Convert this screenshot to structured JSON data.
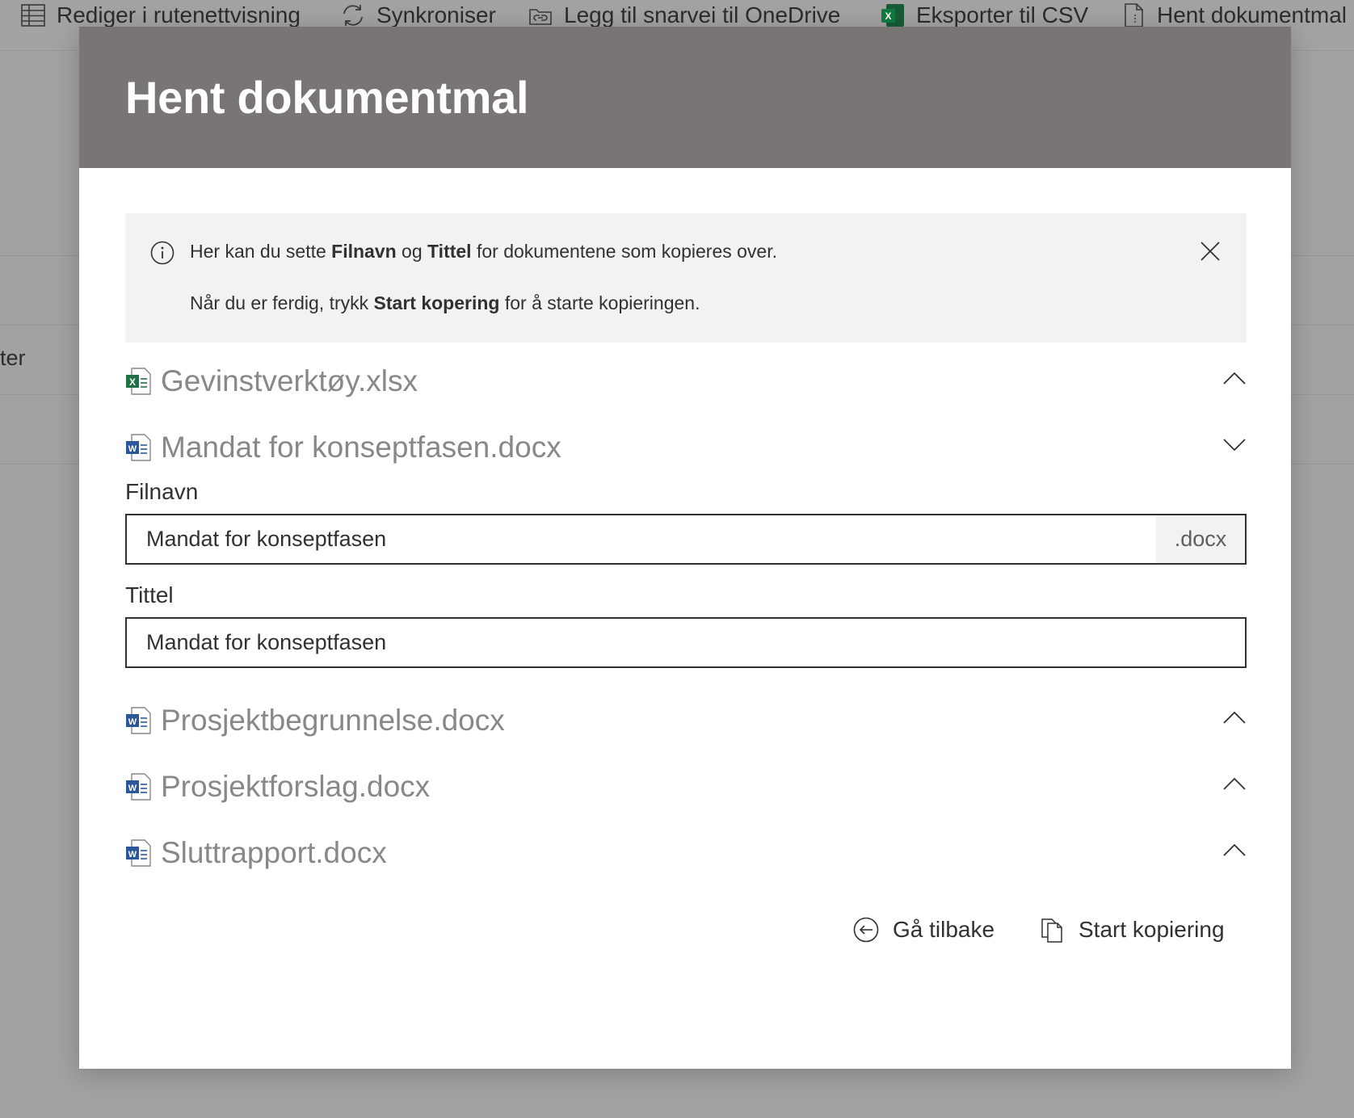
{
  "background": {
    "commands": [
      {
        "label": "Rediger i rutenettvisning",
        "icon": "grid-icon"
      },
      {
        "label": "Synkroniser",
        "icon": "sync-icon"
      },
      {
        "label": "Legg til snarvei til OneDrive",
        "icon": "onedrive-shortcut-icon"
      },
      {
        "label": "Eksporter til CSV",
        "icon": "excel-icon"
      },
      {
        "label": "Hent dokumentmal",
        "icon": "document-template-icon"
      }
    ],
    "partial_text": "ter"
  },
  "dialog": {
    "title": "Hent dokumentmal",
    "info": {
      "line1": {
        "pre": "Her kan du sette ",
        "b1": "Filnavn",
        "mid": " og ",
        "b2": "Tittel",
        "post": " for dokumentene som kopieres over."
      },
      "line2": {
        "pre": "Når du er ferdig, trykk ",
        "b1": "Start kopering",
        "post": " for å starte kopieringen."
      }
    },
    "documents": [
      {
        "name": "Gevinstverktøy.xlsx",
        "type": "excel",
        "expanded": false
      },
      {
        "name": "Mandat for konseptfasen.docx",
        "type": "word",
        "expanded": true
      },
      {
        "name": "Prosjektbegrunnelse.docx",
        "type": "word",
        "expanded": false
      },
      {
        "name": "Prosjektforslag.docx",
        "type": "word",
        "expanded": false
      },
      {
        "name": "Sluttrapport.docx",
        "type": "word",
        "expanded": false
      }
    ],
    "fields": {
      "filename_label": "Filnavn",
      "filename_value": "Mandat for konseptfasen",
      "filename_suffix": ".docx",
      "title_label": "Tittel",
      "title_value": "Mandat for konseptfasen"
    },
    "buttons": {
      "back": "Gå tilbake",
      "start": "Start kopiering"
    }
  },
  "colors": {
    "header_bg": "#797574",
    "overlay_bg": "#a2a2a2",
    "info_bg": "#f3f2f1",
    "excel_green": "#1e7145",
    "word_blue": "#2b579a"
  }
}
